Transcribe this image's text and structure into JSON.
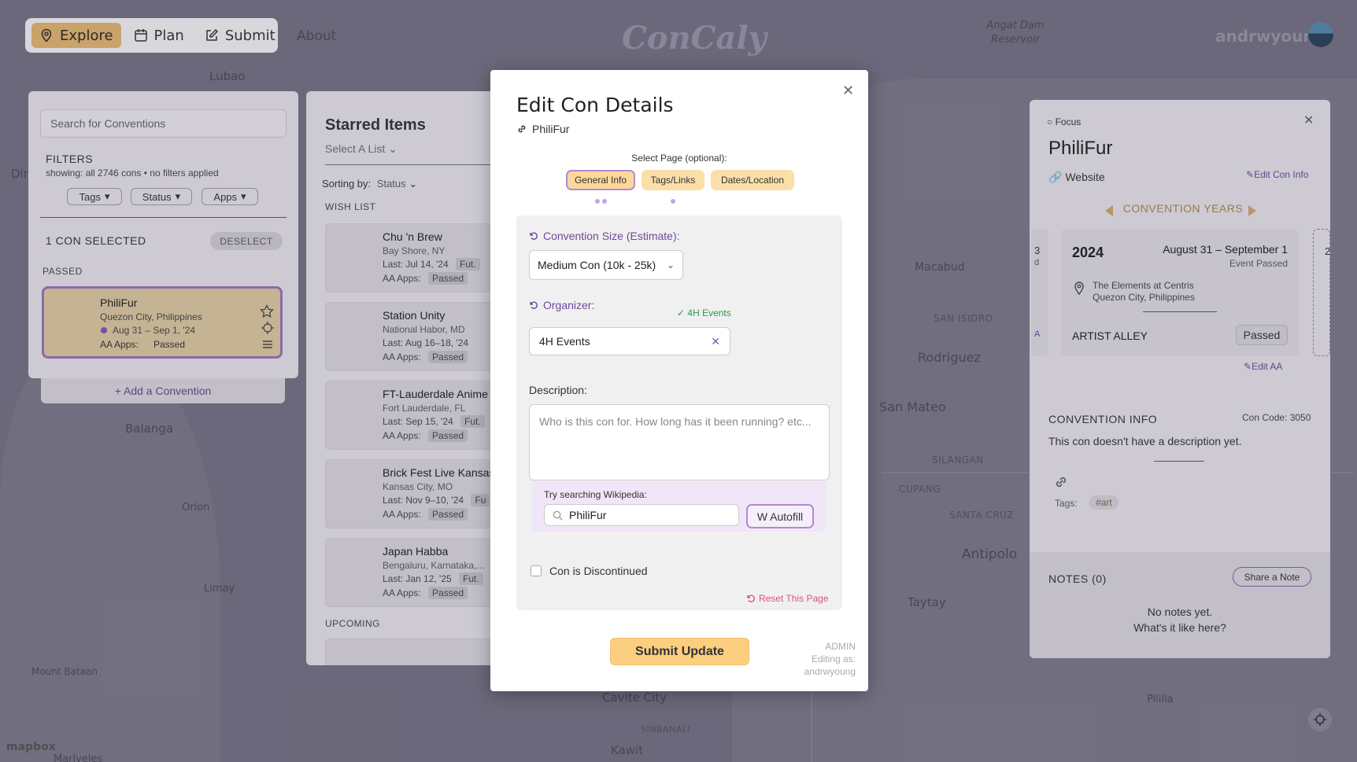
{
  "nav": {
    "explore": "Explore",
    "plan": "Plan",
    "submit": "Submit",
    "about": "About",
    "logo": "ConCaly",
    "username": "andrwyoung"
  },
  "map": {
    "labels": [
      "Lubao",
      "Balanga",
      "Orion",
      "Limay",
      "Mount Bataan",
      "Mariveles",
      "Macabud",
      "SAN ISIDRO",
      "Rodriguez",
      "San Mateo",
      "SILANGAN",
      "CUPANG",
      "SANTA CRUZ",
      "Antipolo",
      "Taytay",
      "Cavite City",
      "SINBANALI",
      "Kawit",
      "Pililla",
      "Angat Dam Reservoir",
      "Dir"
    ],
    "attribution": "mapbox"
  },
  "left_panel": {
    "search_placeholder": "Search for Conventions",
    "filters_title": "FILTERS",
    "filters_sub": "showing: all 2746 cons • no filters applied",
    "filter_buttons": [
      "Tags",
      "Status",
      "Apps"
    ],
    "selected_title": "1 CON SELECTED",
    "deselect": "DESELECT",
    "passed_heading": "PASSED",
    "selected_con": {
      "name": "PhiliFur",
      "location": "Quezon City, Philippines",
      "dates": "Aug 31 – Sep 1, '24",
      "aa_label": "AA Apps:",
      "aa_status": "Passed"
    },
    "add_convention": "+ Add a Convention"
  },
  "starred": {
    "title": "Starred Items",
    "select_list": "Select A List",
    "sort_label": "Sorting by:",
    "sort_value": "Status",
    "wish_list_heading": "WISH LIST",
    "items": [
      {
        "name": "Chu 'n Brew",
        "location": "Bay Shore, NY",
        "last": "Jul 14, '24",
        "future": "Fut.",
        "aa": "Passed"
      },
      {
        "name": "Station Unity",
        "location": "National Habor, MD",
        "last": "Aug 16–18, '24",
        "future": "",
        "aa": "Passed"
      },
      {
        "name": "FT-Lauderdale Anime",
        "location": "Fort Lauderdale, FL",
        "last": "Sep 15, '24",
        "future": "Fut.",
        "aa": "Passed"
      },
      {
        "name": "Brick Fest Live Kansas",
        "location": "Kansas City, MO",
        "last": "Nov 9–10, '24",
        "future": "Fu",
        "aa": "Passed"
      },
      {
        "name": "Japan Habba",
        "location": "Bengaluru, Karnataka,...",
        "last": "Jan 12, '25",
        "future": "Fut.",
        "aa": "Passed"
      }
    ],
    "last_label": "Last:",
    "aa_label": "AA Apps:",
    "upcoming_heading": "UPCOMING"
  },
  "modal": {
    "title": "Edit Con Details",
    "con_name": "PhiliFur",
    "select_page_label": "Select Page (optional):",
    "tabs": [
      "General Info",
      "Tags/Links",
      "Dates/Location"
    ],
    "size_label": "Convention Size (Estimate):",
    "size_value": "Medium Con (10k - 25k)",
    "organizer_label": "Organizer:",
    "organizer_check": "✓ 4H Events",
    "organizer_value": "4H Events",
    "description_label": "Description:",
    "description_placeholder": "Who is this con for. How long has it been running? etc...",
    "wiki_label": "Try searching Wikipedia:",
    "wiki_value": "PhiliFur",
    "autofill": "W Autofill",
    "discontinued": "Con is Discontinued",
    "reset": "Reset This Page",
    "submit": "Submit Update",
    "admin": "ADMIN",
    "editing_as": "Editing as:",
    "editor": "andrwyoung"
  },
  "right_panel": {
    "focus": "Focus",
    "name": "PhiliFur",
    "website": "Website",
    "edit_con_info": "Edit Con Info",
    "convention_years": "CONVENTION YEARS",
    "year_card": {
      "year": "2024",
      "dates": "August 31 – September 1",
      "status": "Event Passed",
      "venue": "The Elements at Centris",
      "city": "Quezon City, Philippines",
      "aa_title": "ARTIST ALLEY",
      "aa_status": "Passed",
      "edit_aa": "Edit AA"
    },
    "side_left": [
      "3",
      "d",
      "A"
    ],
    "side_right": [
      "2"
    ],
    "convention_info": "CONVENTION INFO",
    "con_code": "Con Code: 3050",
    "description": "This con doesn't have a description yet.",
    "tags_label": "Tags:",
    "tag": "#art",
    "notes_title": "NOTES (0)",
    "share_note": "Share a Note",
    "no_notes": "No notes yet.",
    "no_notes_sub": "What's it like here?"
  },
  "colors": {
    "accent_purple": "#b08bd0",
    "submit_orange": "#fbce80",
    "tab_orange": "#fbdfa8",
    "reset_pink": "#e0507a"
  }
}
